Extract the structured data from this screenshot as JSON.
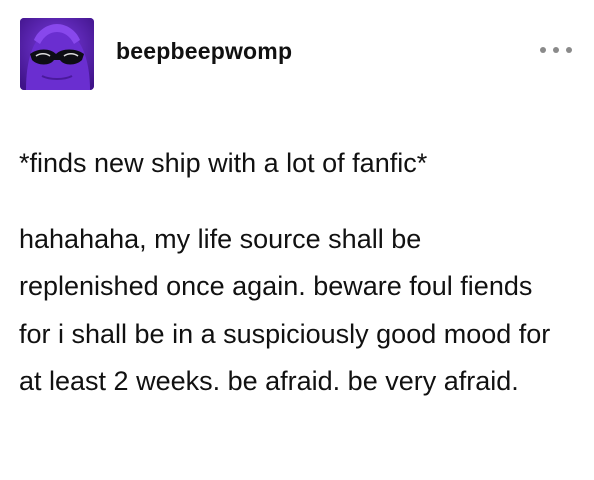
{
  "post": {
    "username": "beepbeepwomp",
    "more_icon": "ellipsis-icon",
    "avatar_icon": "avatar-purple-figure-sunglasses",
    "paragraphs": [
      "*finds new ship with a lot of fanfic*",
      "hahahaha, my life source shall be replenished once again. beware foul fiends for i shall be in a suspiciously good mood for at least 2 weeks. be afraid. be very afraid."
    ]
  },
  "colors": {
    "avatar_bg": "#5b22b8",
    "text": "#111111",
    "muted": "#8a8a8a"
  }
}
